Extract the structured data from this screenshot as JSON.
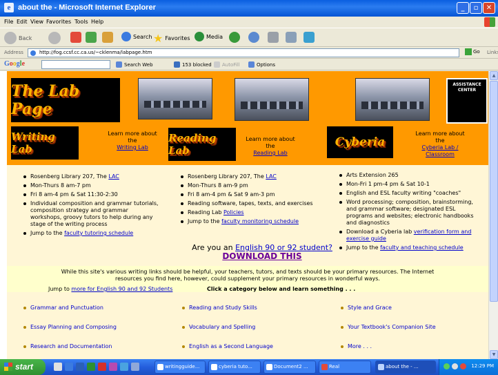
{
  "window": {
    "title": "about the - Microsoft Internet Explorer"
  },
  "menubar": [
    "File",
    "Edit",
    "View",
    "Favorites",
    "Tools",
    "Help"
  ],
  "toolbar": {
    "back": "Back",
    "search": "Search",
    "favorites": "Favorites",
    "media": "Media"
  },
  "address": {
    "label": "Address",
    "url": "http://fog.ccsf.cc.ca.us/~cklenma/labpage.htm",
    "go": "Go",
    "links": "Links"
  },
  "google": {
    "logo": "Google",
    "search_web": "Search Web",
    "blocked": "153 blocked",
    "autofill": "AutoFill",
    "options": "Options"
  },
  "page": {
    "banner_title": "The Lab Page",
    "assistance": "ASSISTANCE CENTER",
    "writing": {
      "logo": "Writing Lab",
      "learn_more": "Learn more about the",
      "link": "Writing Lab",
      "items": [
        {
          "text": "Rosenberg Library 207, The ",
          "link": "LAC"
        },
        {
          "text": "Mon-Thurs 8 am-7 pm"
        },
        {
          "text": "Fri 8 am-4 pm & Sat 11:30-2:30"
        },
        {
          "text": "Individual composition and grammar tutorials, composition strategy and grammar workshops, groovy tutors to help during any stage of the writing process"
        },
        {
          "text": "Jump to the ",
          "link": "faculty tutoring schedule"
        }
      ]
    },
    "reading": {
      "logo": "Reading Lab",
      "learn_more": "Learn more about the",
      "link": "Reading Lab",
      "items": [
        {
          "text": "Rosenberg Library 207, The ",
          "link": "LAC"
        },
        {
          "text": "Mon-Thurs 8 am-9 pm"
        },
        {
          "text": "Fri 8 am-4 pm & Sat 9 am-3 pm"
        },
        {
          "text": "Reading software, tapes, texts, and exercises"
        },
        {
          "text": "Reading Lab ",
          "link": "Policies"
        },
        {
          "text": "Jump to the ",
          "link": "faculty monitoring schedule"
        }
      ]
    },
    "cyberia": {
      "logo": "Cyberia",
      "learn_more": "Learn more about the",
      "link": "Cyberia Lab / Classroom",
      "items": [
        {
          "text": "Arts Extension 265"
        },
        {
          "text": "Mon-Fri 1 pm-4 pm & Sat 10-1"
        },
        {
          "text": "English and ESL faculty writing \"coaches\""
        },
        {
          "text": "Word processing; composition, brainstorming, and grammar software; designated ESL programs and websites; electronic handbooks and diagnostics"
        },
        {
          "text": "Download a Cyberia lab ",
          "link": "verification form and exercise guide"
        },
        {
          "text": "Jump to the ",
          "link": "faculty and teaching schedule"
        }
      ]
    },
    "english": {
      "question": "Are you an ",
      "link": "English 90 or 92 student?",
      "download": "DOWNLOAD THIS"
    },
    "notice": "While this site's various writing links should be helpful, your teachers, tutors, and texts should be your primary resources.  The Internet resources you find here, however, could supplement your primary resources in wonderful ways.",
    "jump": {
      "text": "Jump to ",
      "link": "more for English 90 and 92 Students"
    },
    "click_category": "Click a category below and learn something . . .",
    "categories": [
      "Grammar and Punctuation",
      "Reading and Study Skills",
      "Style and Grace",
      "Essay Planning and Composing",
      "Vocabulary and Spelling",
      "Your Textbook's Companion Site",
      "Research and Documentation",
      "English as a Second Language",
      "More . . ."
    ]
  },
  "taskbar": {
    "start": "start",
    "tasks": [
      "writingguide...",
      "cyberia tuto...",
      "Document2 ...",
      "Real",
      "about the - ..."
    ],
    "clock": "12:29 PM"
  }
}
